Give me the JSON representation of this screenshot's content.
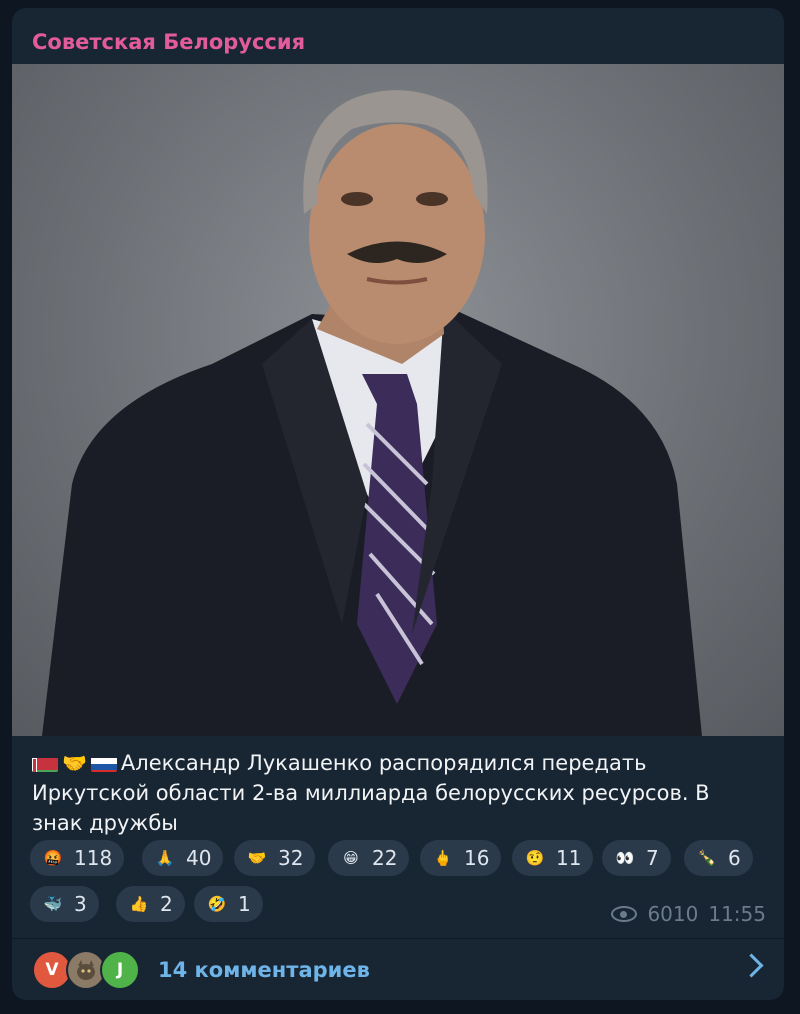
{
  "post": {
    "channel_name": "Советская Белоруссия",
    "text": "Александр Лукашенко распорядился передать Иркутской области 2-ва миллиарда белорусских ресурсов. В знак дружбы",
    "views": "6010",
    "time": "11:55"
  },
  "reactions": [
    {
      "icon": "angry-swearing-face-icon",
      "emoji": "🤬",
      "count": "118"
    },
    {
      "icon": "praying-hands-icon",
      "emoji": "🙏",
      "count": "40"
    },
    {
      "icon": "handshake-icon",
      "emoji": "🤝",
      "count": "32"
    },
    {
      "icon": "grinning-face-icon",
      "emoji": "😁",
      "count": "22"
    },
    {
      "icon": "middle-finger-icon",
      "emoji": "🖕",
      "count": "16"
    },
    {
      "icon": "raised-eyebrow-face-icon",
      "emoji": "🤨",
      "count": "11"
    },
    {
      "icon": "eyes-icon",
      "emoji": "👀",
      "count": "7"
    },
    {
      "icon": "champagne-icon",
      "emoji": "🍾",
      "count": "6"
    },
    {
      "icon": "whale-icon",
      "emoji": "🐳",
      "count": "3"
    },
    {
      "icon": "thumbs-up-icon",
      "emoji": "👍",
      "count": "2"
    },
    {
      "icon": "rolling-laughing-face-icon",
      "emoji": "🤣",
      "count": "1"
    }
  ],
  "comments": {
    "label": "14 комментариев",
    "avatars": [
      {
        "letter": "V",
        "color": "#e0593f"
      },
      {
        "letter": "",
        "color": "#8a7a66"
      },
      {
        "letter": "J",
        "color": "#4fb34a"
      }
    ]
  },
  "colors": {
    "background": "#0e1621",
    "bubble": "#182533",
    "channel_name": "#e25c9c",
    "link": "#6fb4e8",
    "reaction_pill": "#2b3a4b"
  }
}
